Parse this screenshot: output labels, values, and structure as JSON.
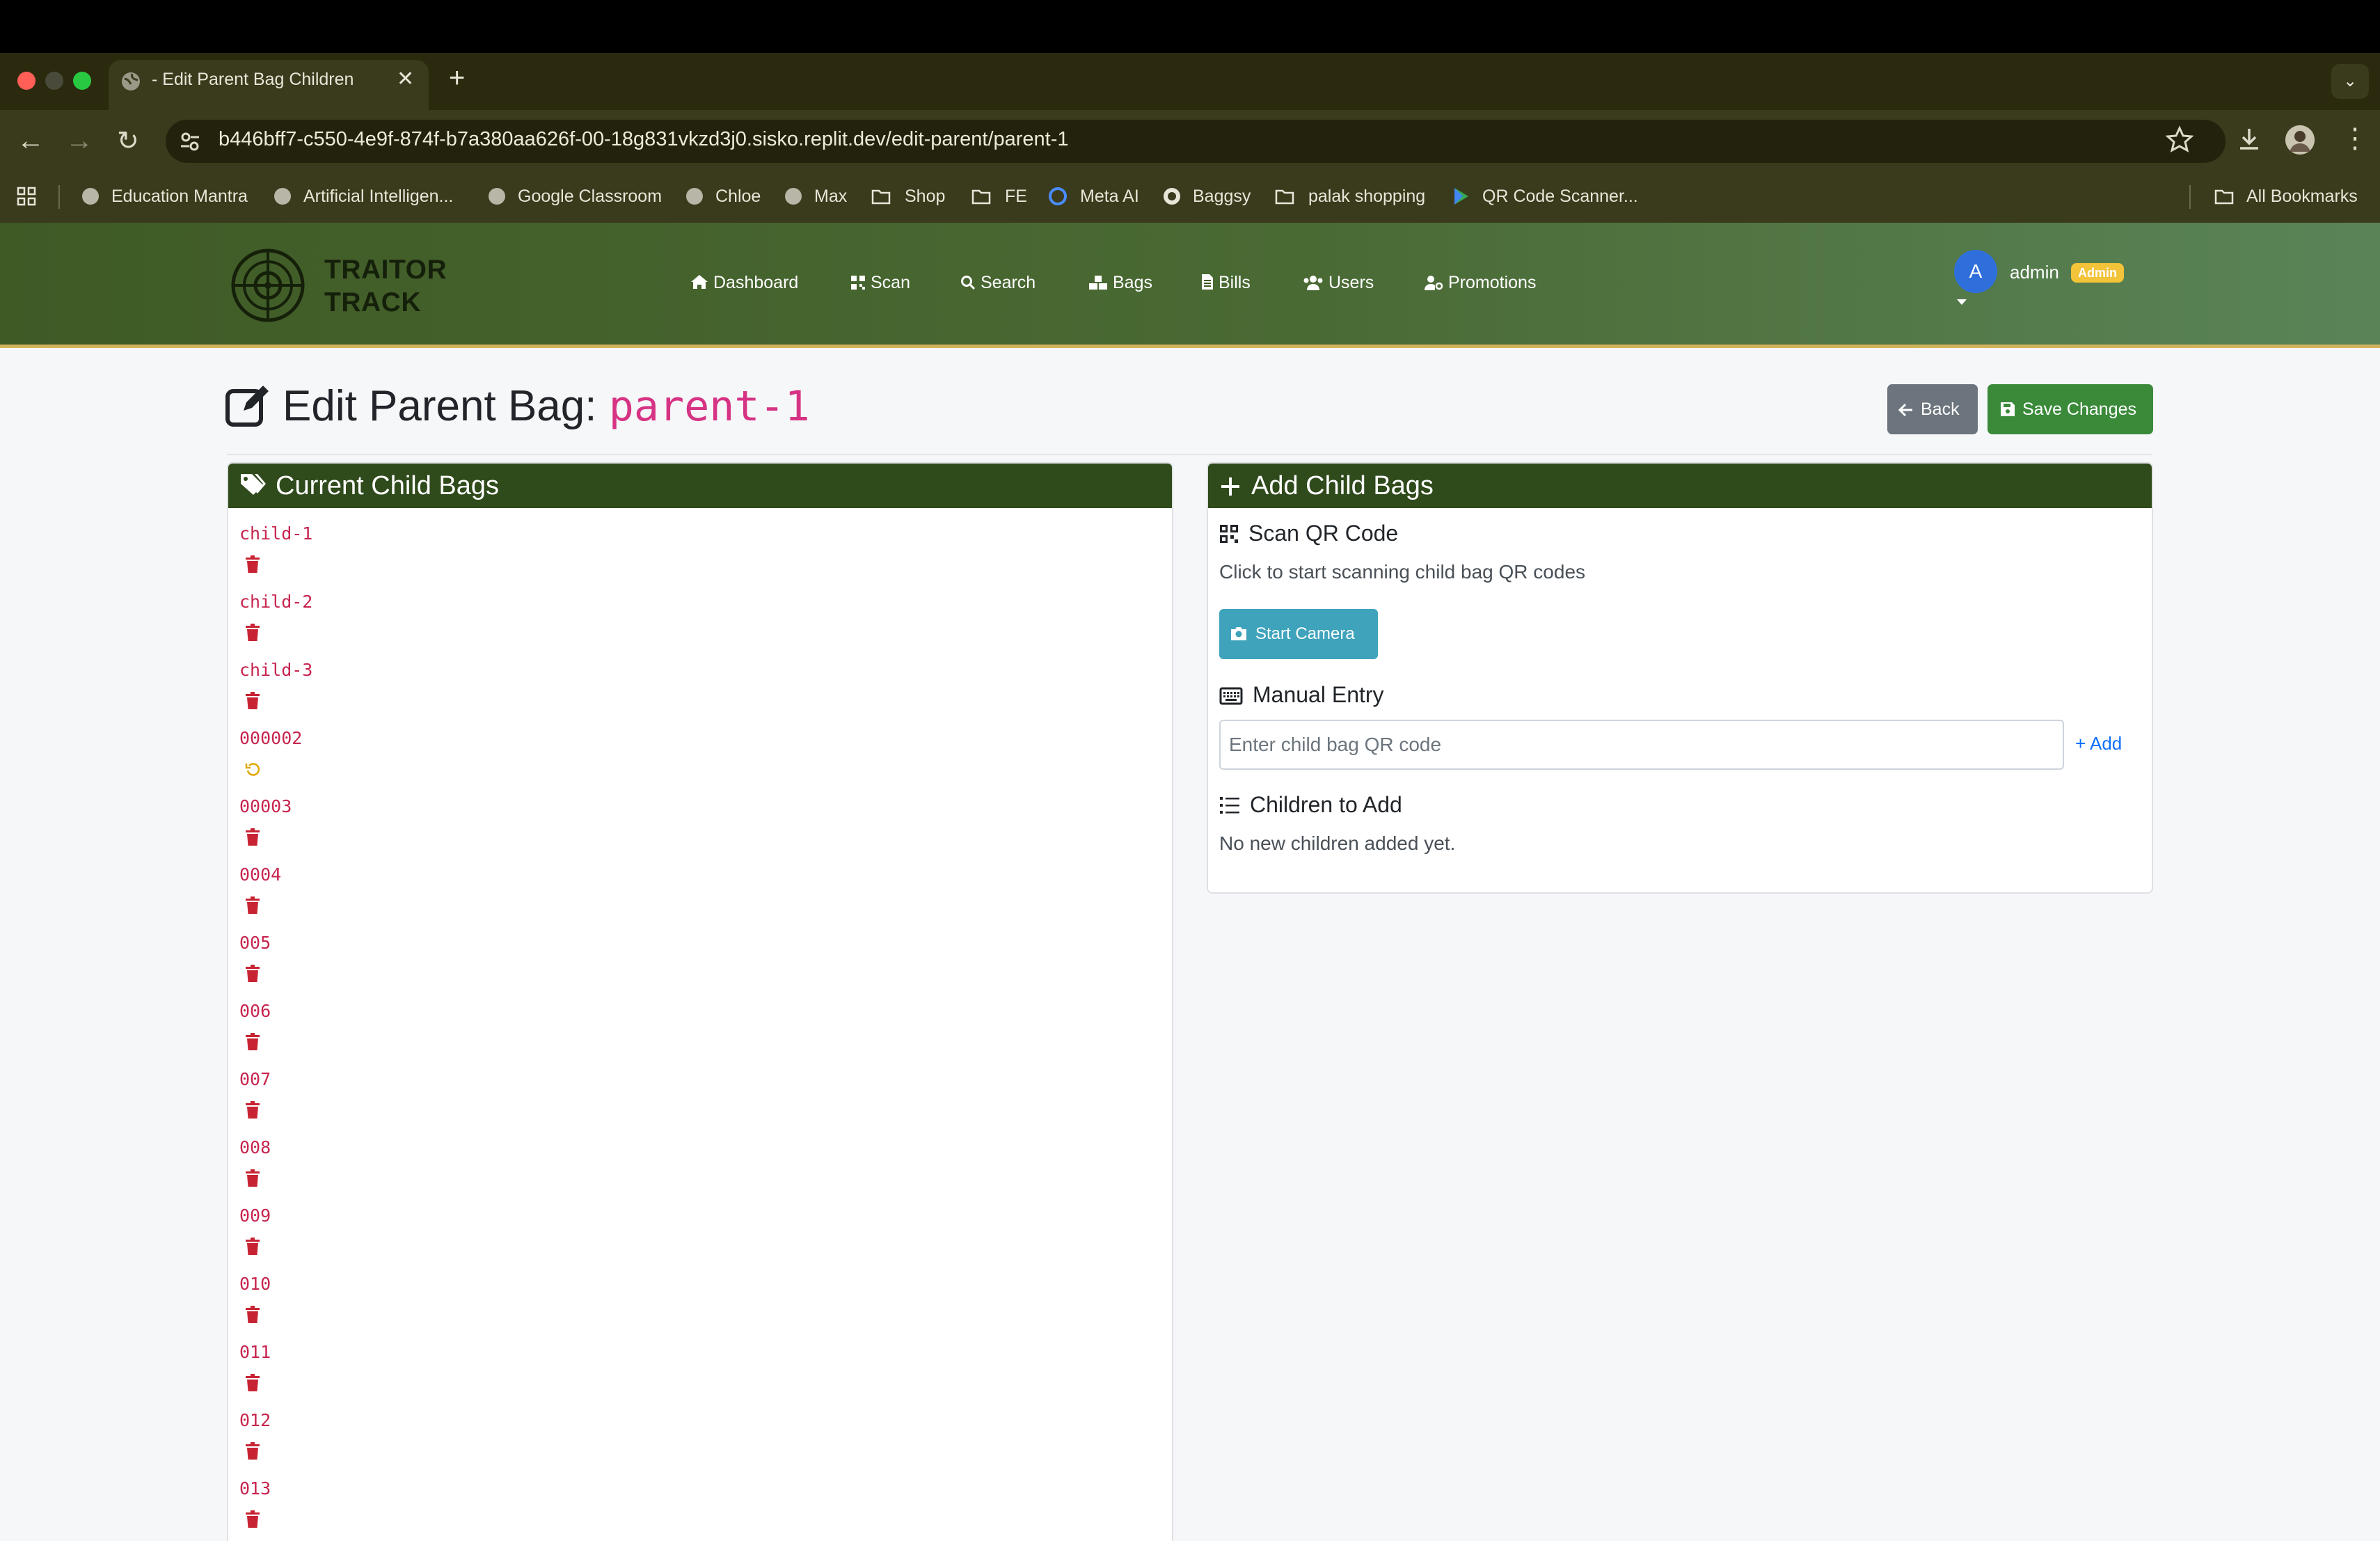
{
  "browser": {
    "tab_title": "- Edit Parent Bag Children",
    "url": "b446bff7-c550-4e9f-874f-b7a380aa626f-00-18g831vkzd3j0.sisko.replit.dev/edit-parent/parent-1",
    "bookmarks": [
      "Education Mantra",
      "Artificial Intelligen...",
      "Google Classroom",
      "Chloe",
      "Max",
      "Shop",
      "FE",
      "Meta AI",
      "Baggsy",
      "palak shopping",
      "QR Code Scanner..."
    ],
    "all_bookmarks": "All Bookmarks"
  },
  "app": {
    "logo_line1": "TRAITOR",
    "logo_line2": "TRACK",
    "nav": [
      "Dashboard",
      "Scan",
      "Search",
      "Bags",
      "Bills",
      "Users",
      "Promotions"
    ],
    "user": {
      "avatar_letter": "A",
      "name": "admin",
      "role_badge": "Admin"
    }
  },
  "page": {
    "title_prefix": "Edit Parent Bag:",
    "parent_code": "parent-1",
    "back_label": "Back",
    "save_label": "Save Changes"
  },
  "current_children": {
    "heading": "Current Child Bags",
    "items": [
      {
        "code": "child-1",
        "action": "delete"
      },
      {
        "code": "child-2",
        "action": "delete"
      },
      {
        "code": "child-3",
        "action": "delete"
      },
      {
        "code": "000002",
        "action": "undo"
      },
      {
        "code": "00003",
        "action": "delete"
      },
      {
        "code": "0004",
        "action": "delete"
      },
      {
        "code": "005",
        "action": "delete"
      },
      {
        "code": "006",
        "action": "delete"
      },
      {
        "code": "007",
        "action": "delete"
      },
      {
        "code": "008",
        "action": "delete"
      },
      {
        "code": "009",
        "action": "delete"
      },
      {
        "code": "010",
        "action": "delete"
      },
      {
        "code": "011",
        "action": "delete"
      },
      {
        "code": "012",
        "action": "delete"
      },
      {
        "code": "013",
        "action": "delete"
      }
    ]
  },
  "add_children": {
    "heading": "Add Child Bags",
    "scan_heading": "Scan QR Code",
    "scan_helper": "Click to start scanning child bag QR codes",
    "camera_label": "Start Camera",
    "manual_heading": "Manual Entry",
    "input_placeholder": "Enter child bag QR code",
    "input_value": "",
    "add_label": "Add",
    "to_add_heading": "Children to Add",
    "empty_text": "No new children added yet."
  },
  "colors": {
    "nav_green": "#3f5a25",
    "card_head": "#2f4a1b",
    "save_green": "#3a8a3a",
    "camera_teal": "#3fa3bc",
    "code_pink": "#d63384",
    "delete_red": "#c82333",
    "undo_yellow": "#e0a800"
  }
}
